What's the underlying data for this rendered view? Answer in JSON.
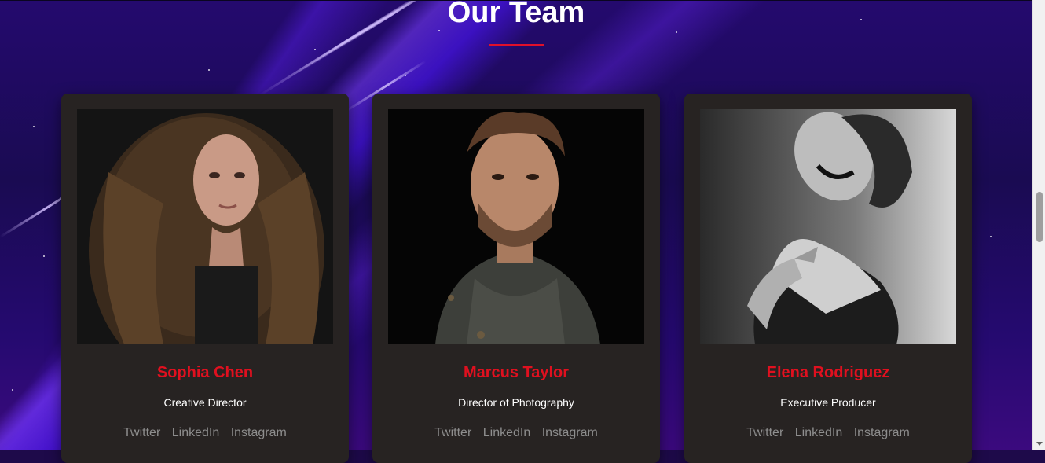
{
  "section": {
    "title": "Our Team"
  },
  "members": [
    {
      "name": "Sophia Chen",
      "role": "Creative Director",
      "social": [
        "Twitter",
        "LinkedIn",
        "Instagram"
      ]
    },
    {
      "name": "Marcus Taylor",
      "role": "Director of Photography",
      "social": [
        "Twitter",
        "LinkedIn",
        "Instagram"
      ]
    },
    {
      "name": "Elena Rodriguez",
      "role": "Executive Producer",
      "social": [
        "Twitter",
        "LinkedIn",
        "Instagram"
      ]
    }
  ],
  "colors": {
    "accent": "#e0101f",
    "card": "#272322",
    "social_link": "#8e8e8e"
  }
}
